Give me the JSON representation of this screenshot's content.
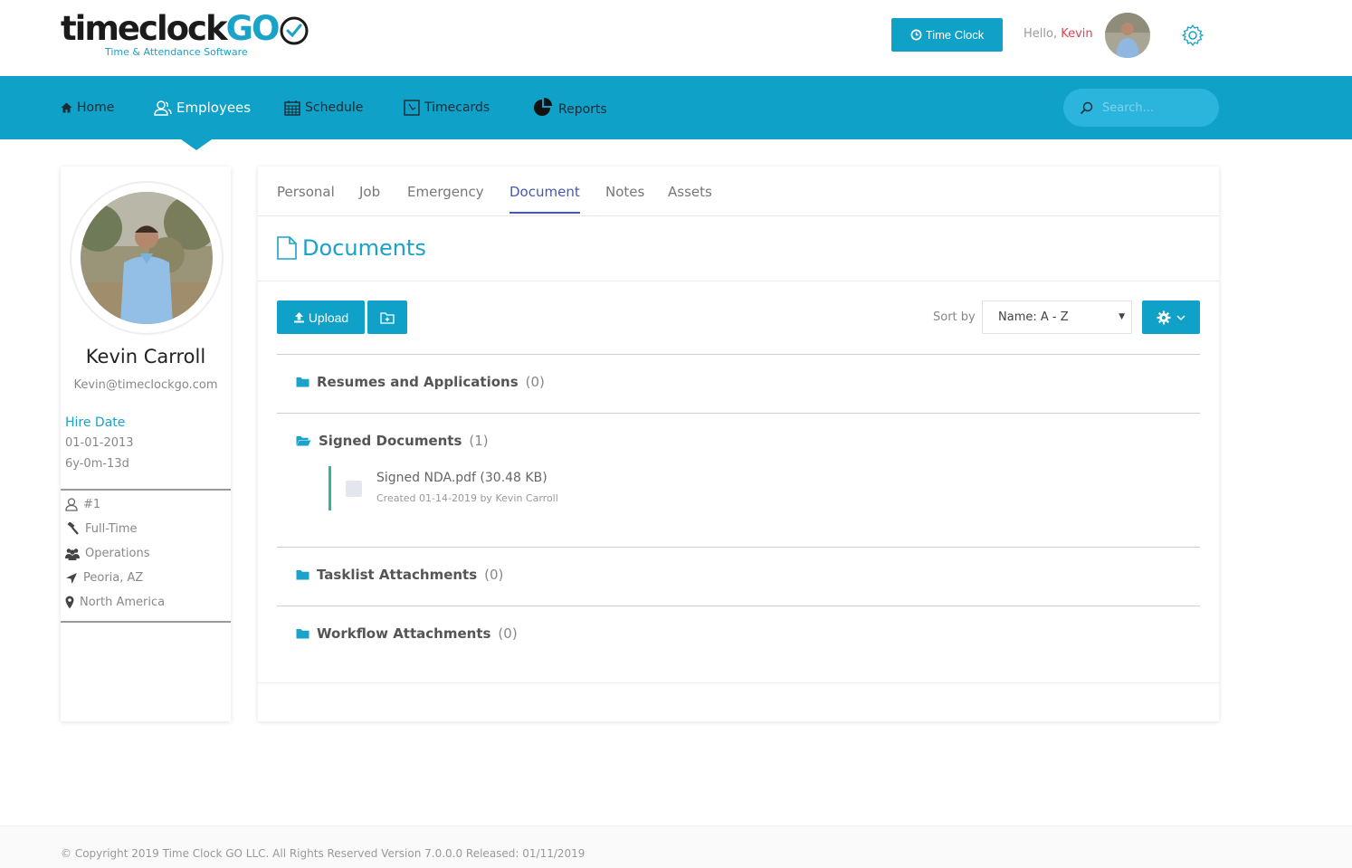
{
  "brand": {
    "name_main": "timeclock",
    "name_accent": "GO",
    "tagline": "Time & Attendance Software",
    "accent_color": "#0fa1c8"
  },
  "header": {
    "time_clock_button": "Time Clock",
    "greeting": "Hello, ",
    "user_first_name": "Kevin"
  },
  "nav": {
    "items": [
      {
        "label": "Home",
        "icon": "home-icon"
      },
      {
        "label": "Employees",
        "icon": "users-icon"
      },
      {
        "label": "Schedule",
        "icon": "calendar-icon"
      },
      {
        "label": "Timecards",
        "icon": "timecard-icon"
      },
      {
        "label": "Reports",
        "icon": "pie-chart-icon"
      }
    ],
    "active": "Employees",
    "search_placeholder": "Search..."
  },
  "profile": {
    "name": "Kevin Carroll",
    "email": "Kevin@timeclockgo.com",
    "hire_date_label": "Hire Date",
    "hire_date": "01-01-2013",
    "tenure": "6y-0m-13d",
    "employee_id": "#1",
    "employment_type": "Full-Time",
    "department": "Operations",
    "location": "Peoria, AZ",
    "region": "North America"
  },
  "tabs": {
    "items": [
      "Personal",
      "Job",
      "Emergency",
      "Document",
      "Notes",
      "Assets"
    ],
    "active": "Document"
  },
  "documents": {
    "title": "Documents",
    "upload_button": "Upload",
    "sort_label": "Sort by",
    "sort_value": "Name: A - Z",
    "folders": [
      {
        "name": "Resumes and Applications",
        "count": "(0)",
        "open": false
      },
      {
        "name": "Signed Documents",
        "count": "(1)",
        "open": true
      },
      {
        "name": "Tasklist Attachments",
        "count": "(0)",
        "open": false
      },
      {
        "name": "Workflow Attachments",
        "count": "(0)",
        "open": false
      }
    ],
    "files": [
      {
        "name": "Signed NDA.pdf (30.48 KB)",
        "meta": "Created 01-14-2019 by Kevin Carroll"
      }
    ]
  },
  "footer": {
    "text": "© Copyright 2019 Time Clock GO LLC. All Rights Reserved Version 7.0.0.0 Released: 01/11/2019"
  }
}
